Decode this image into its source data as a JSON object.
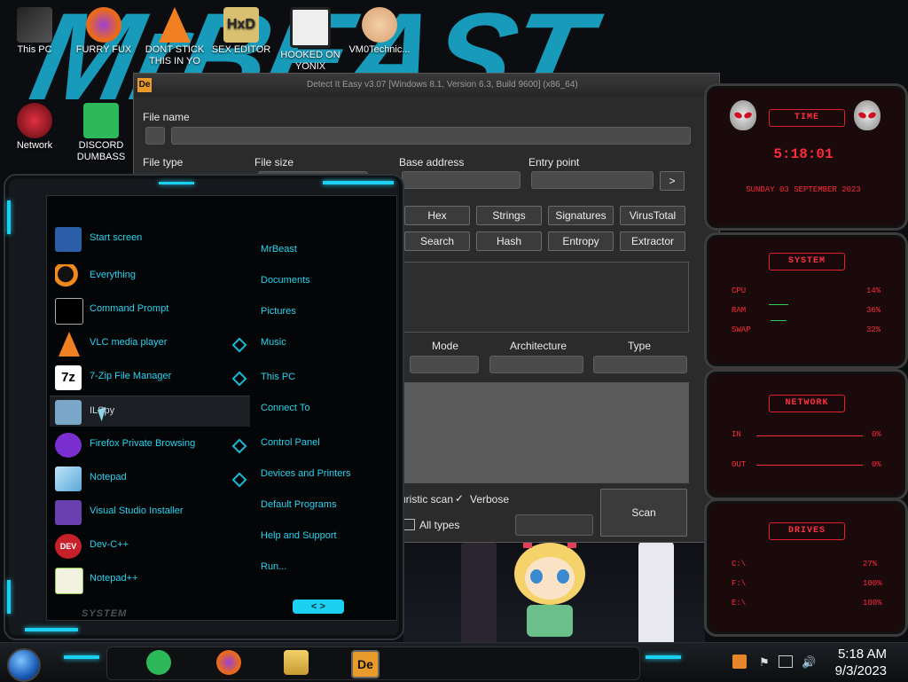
{
  "desktop": {
    "wallpaper_text": "MrBEAST",
    "icons": [
      {
        "label": "This PC",
        "color": "#333"
      },
      {
        "label": "FURRY FUX",
        "color": "#e86a1c"
      },
      {
        "label": "DONT STICK THIS IN YO",
        "color": "#f08020"
      },
      {
        "label": "SEX EDITOR",
        "color": "#c8a030"
      },
      {
        "label": "HOOKED ON YONIX",
        "color": "#444"
      },
      {
        "label": "VM0Technic...",
        "color": "#d8a070"
      },
      {
        "label": "Network",
        "color": "#8a1a22"
      },
      {
        "label": "DISCORD DUMBASS",
        "color": "#2db85a"
      }
    ]
  },
  "app": {
    "title": "Detect It Easy v3.07 [Windows 8.1, Version 6.3, Build 9600] (x86_64)",
    "icon": "De",
    "file_name_label": "File name",
    "file_type_label": "File type",
    "file_size_label": "File size",
    "base_address_label": "Base address",
    "entry_point_label": "Entry point",
    "entry_point_btn": ">",
    "buttons_row1": [
      "Hex",
      "Strings",
      "Signatures",
      "VirusTotal"
    ],
    "buttons_row2": [
      "Search",
      "Hash",
      "Entropy",
      "Extractor"
    ],
    "mode_label": "Mode",
    "arch_label": "Architecture",
    "type_label": "Type",
    "heuristic_label": "uristic scan",
    "verbose_label": "Verbose",
    "verbose_check": "✓",
    "all_types_label": "All types",
    "scan_btn": "Scan"
  },
  "start_menu": {
    "left_items": [
      {
        "label": "Start screen",
        "color": "#2a5fa8"
      },
      {
        "label": "Everything",
        "color": "#f08a1a"
      },
      {
        "label": "Command Prompt",
        "color": "#111"
      },
      {
        "label": "VLC media player",
        "color": "#f08020"
      },
      {
        "label": "7-Zip File Manager",
        "color": "#eee"
      },
      {
        "label": "ILSpy",
        "color": "#7aa6c8"
      },
      {
        "label": "Firefox Private Browsing",
        "color": "#7a2fd0"
      },
      {
        "label": "Notepad",
        "color": "#6ab0e0"
      },
      {
        "label": "Visual Studio Installer",
        "color": "#6a3fb0"
      },
      {
        "label": "Dev-C++",
        "color": "#c8202a"
      },
      {
        "label": "Notepad++",
        "color": "#8bc34a"
      }
    ],
    "right_items": [
      "MrBeast",
      "Documents",
      "Pictures",
      "Music",
      "This PC",
      "Connect To",
      "Control Panel",
      "Devices and Printers",
      "Default Programs",
      "Help and Support",
      "Run..."
    ],
    "footer_label": "SYSTEM",
    "footer_nav": "< >"
  },
  "gadgets": {
    "time": {
      "header": "TIME",
      "clock": "5:18:01",
      "date": "SUNDAY 03 SEPTEMBER 2023"
    },
    "system": {
      "header": "SYSTEM",
      "rows": [
        {
          "name": "CPU",
          "value": "14%"
        },
        {
          "name": "RAM",
          "value": "36%"
        },
        {
          "name": "SWAP",
          "value": "32%"
        }
      ]
    },
    "network": {
      "header": "NETWORK",
      "rows": [
        {
          "name": "IN",
          "value": "0%"
        },
        {
          "name": "OUT",
          "value": "0%"
        }
      ]
    },
    "drives": {
      "header": "DRIVES",
      "rows": [
        {
          "name": "C:\\",
          "value": "27%"
        },
        {
          "name": "F:\\",
          "value": "100%"
        },
        {
          "name": "E:\\",
          "value": "100%"
        }
      ]
    }
  },
  "taskbar": {
    "time": "5:18 AM",
    "date": "9/3/2023",
    "pinned": [
      "discord",
      "firefox",
      "file-explorer",
      "detect-it-easy"
    ]
  }
}
